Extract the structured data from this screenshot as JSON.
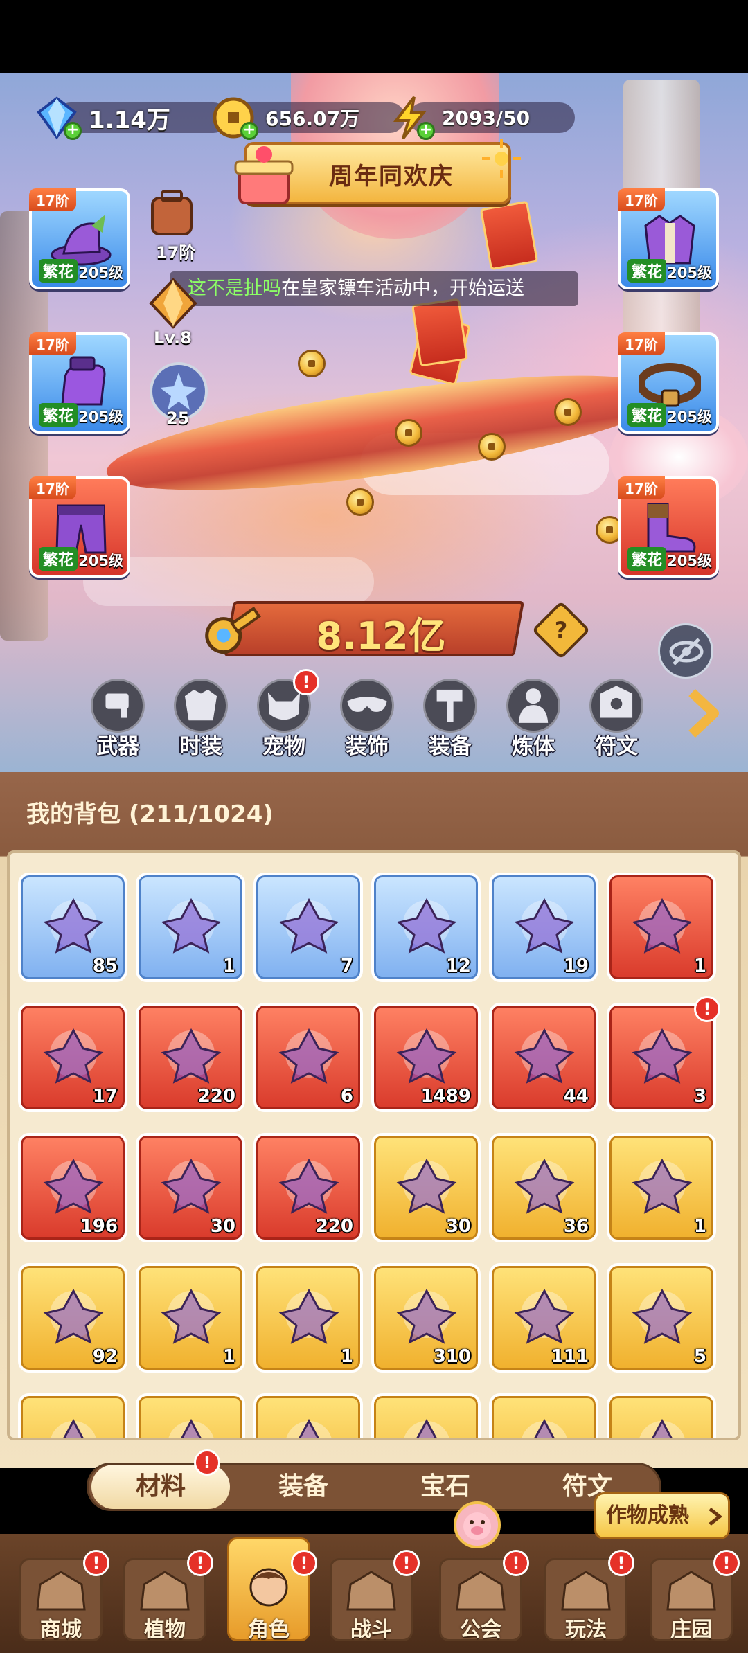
{
  "currency": {
    "gems": "1.14万",
    "gold": "656.07万",
    "energy": "2093/50"
  },
  "event_banner": "周年同欢庆",
  "marquee": {
    "highlight": "这不是扯吗",
    "text": "在皇家镖车活动中，开始运送"
  },
  "slots_left": [
    {
      "tier": "17阶",
      "flower": "繁花",
      "level": "205级",
      "color": "blue",
      "icon": "hat-icon"
    },
    {
      "tier": "17阶",
      "flower": "繁花",
      "level": "205级",
      "color": "blue",
      "icon": "glove-icon"
    },
    {
      "tier": "17阶",
      "flower": "繁花",
      "level": "205级",
      "color": "red",
      "icon": "pants-icon"
    }
  ],
  "slots_right": [
    {
      "tier": "17阶",
      "flower": "繁花",
      "level": "205级",
      "color": "blue",
      "icon": "coat-icon"
    },
    {
      "tier": "17阶",
      "flower": "繁花",
      "level": "205级",
      "color": "blue",
      "icon": "belt-icon"
    },
    {
      "tier": "17阶",
      "flower": "繁花",
      "level": "205级",
      "color": "red",
      "icon": "boots-icon"
    }
  ],
  "middle": {
    "backpack_tier": "17阶",
    "crystal_level": "Lv.8",
    "star_count": "25"
  },
  "power": "8.12亿",
  "help_mark": "?",
  "categories": [
    {
      "label": "武器",
      "icon": "weapon-icon",
      "badge": false
    },
    {
      "label": "时装",
      "icon": "costume-icon",
      "badge": false
    },
    {
      "label": "宠物",
      "icon": "pet-icon",
      "badge": true
    },
    {
      "label": "装饰",
      "icon": "mask-icon",
      "badge": false
    },
    {
      "label": "装备",
      "icon": "hammer-icon",
      "badge": false
    },
    {
      "label": "炼体",
      "icon": "body-icon",
      "badge": false
    },
    {
      "label": "符文",
      "icon": "rune-icon",
      "badge": false
    }
  ],
  "bag": {
    "title": "我的背包 (211/1024)",
    "items": [
      {
        "count": "85",
        "color": "blue",
        "icon": "scarab-icon"
      },
      {
        "count": "1",
        "color": "blue",
        "icon": "syringe-icon"
      },
      {
        "count": "7",
        "color": "blue",
        "icon": "syringe-cloud-icon"
      },
      {
        "count": "12",
        "color": "blue",
        "icon": "star-icon"
      },
      {
        "count": "19",
        "color": "blue",
        "icon": "orb-ring-icon"
      },
      {
        "count": "1",
        "color": "red",
        "icon": "clock-book-icon"
      },
      {
        "count": "17",
        "color": "red",
        "icon": "cube-icon"
      },
      {
        "count": "220",
        "color": "red",
        "icon": "crystal-star-icon"
      },
      {
        "count": "6",
        "color": "red",
        "icon": "moon-star-icon"
      },
      {
        "count": "1489",
        "color": "red",
        "icon": "potion-icon"
      },
      {
        "count": "44",
        "color": "red",
        "icon": "capsule-icon"
      },
      {
        "count": "3",
        "color": "red",
        "icon": "chest-icon",
        "badge": true
      },
      {
        "count": "196",
        "color": "red",
        "icon": "hexagram-icon"
      },
      {
        "count": "30",
        "color": "red",
        "icon": "knot-icon"
      },
      {
        "count": "220",
        "color": "red",
        "icon": "cubes-icon"
      },
      {
        "count": "30",
        "color": "gold",
        "icon": "vase-icon"
      },
      {
        "count": "36",
        "color": "gold",
        "icon": "dart-icon"
      },
      {
        "count": "1",
        "color": "gold",
        "icon": "water-drop-icon"
      },
      {
        "count": "92",
        "color": "gold",
        "icon": "skull-card-icon"
      },
      {
        "count": "1",
        "color": "gold",
        "icon": "medal-icon"
      },
      {
        "count": "1",
        "color": "gold",
        "icon": "ruby-key-icon"
      },
      {
        "count": "310",
        "color": "gold",
        "icon": "key-icon"
      },
      {
        "count": "111",
        "color": "gold",
        "icon": "pyramid-icon"
      },
      {
        "count": "5",
        "color": "gold",
        "icon": "mushroom-icon"
      },
      {
        "count": "",
        "color": "gold",
        "icon": "item-icon"
      },
      {
        "count": "",
        "color": "gold",
        "icon": "item-icon"
      },
      {
        "count": "",
        "color": "gold",
        "icon": "item-icon"
      },
      {
        "count": "",
        "color": "gold",
        "icon": "item-icon"
      },
      {
        "count": "",
        "color": "gold",
        "icon": "item-icon"
      },
      {
        "count": "",
        "color": "gold",
        "icon": "item-icon"
      }
    ]
  },
  "subtabs": [
    "材料",
    "装备",
    "宝石",
    "符文"
  ],
  "crop_button": "作物成熟",
  "nav": [
    {
      "label": "商城",
      "icon": "shop-icon"
    },
    {
      "label": "植物",
      "icon": "plant-icon"
    },
    {
      "label": "角色",
      "icon": "character-icon",
      "active": true
    },
    {
      "label": "战斗",
      "icon": "battle-icon"
    },
    {
      "label": "公会",
      "icon": "guild-icon"
    },
    {
      "label": "玩法",
      "icon": "gameplay-icon"
    },
    {
      "label": "庄园",
      "icon": "manor-icon"
    }
  ],
  "colors": {
    "accent_gold": "#f3b640",
    "alert_red": "#e53128",
    "flower_green": "#238e25"
  }
}
